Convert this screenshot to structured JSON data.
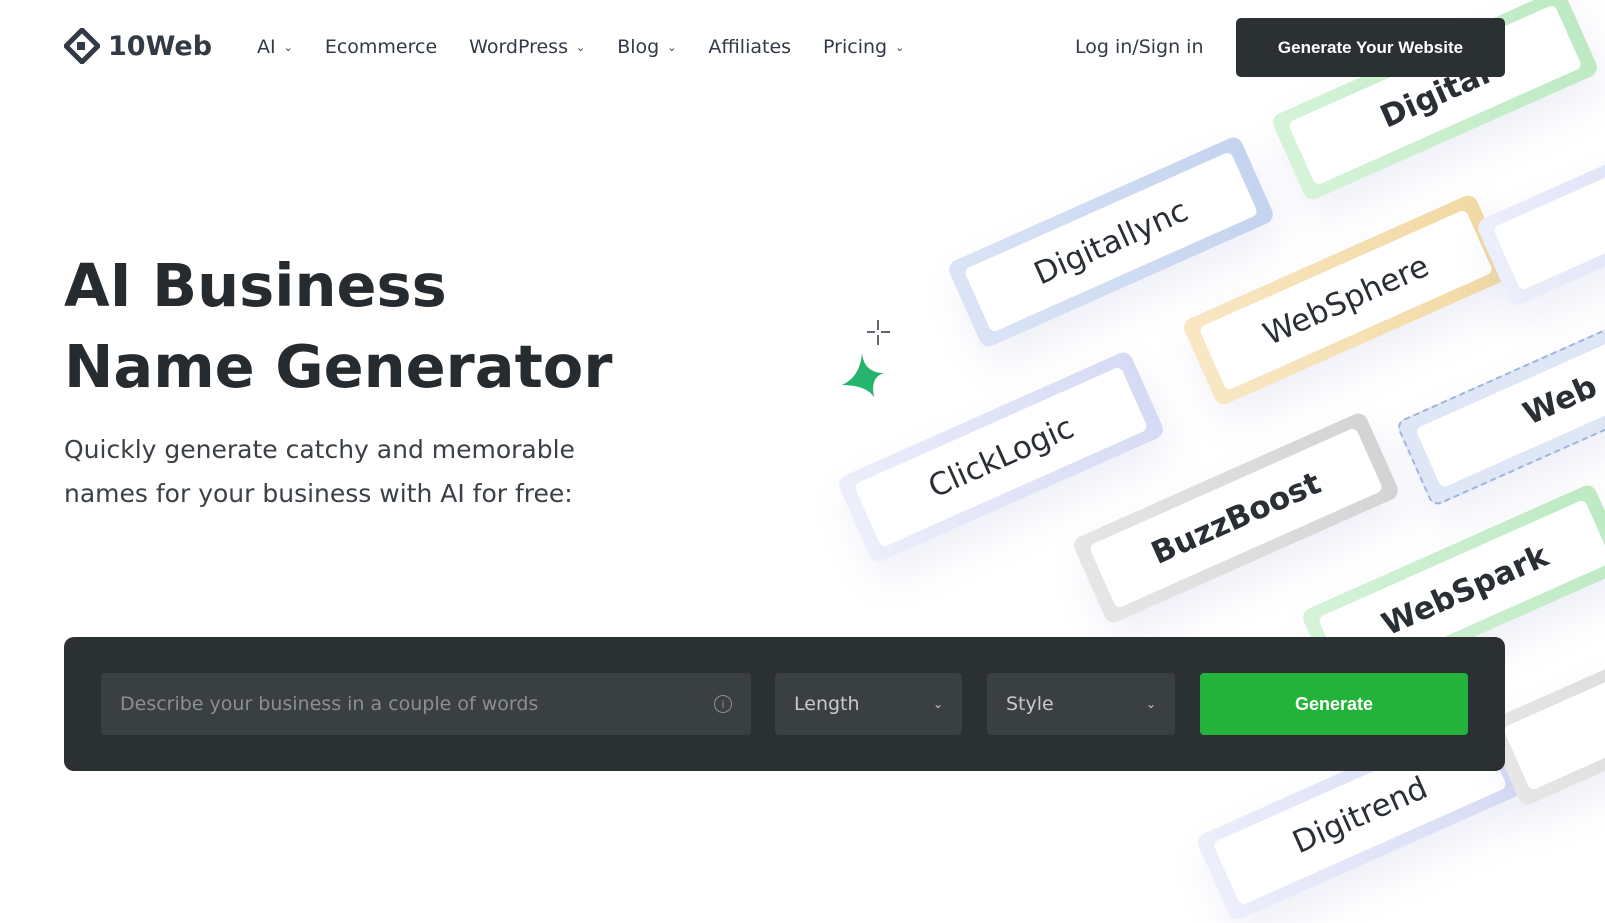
{
  "nav": {
    "brand": "10Web",
    "items": [
      {
        "label": "AI",
        "dropdown": true
      },
      {
        "label": "Ecommerce",
        "dropdown": false
      },
      {
        "label": "WordPress",
        "dropdown": true
      },
      {
        "label": "Blog",
        "dropdown": true
      },
      {
        "label": "Affiliates",
        "dropdown": false
      },
      {
        "label": "Pricing",
        "dropdown": true
      }
    ],
    "login": "Log in/Sign in",
    "cta": "Generate Your Website"
  },
  "hero": {
    "title_line1": "AI Business",
    "title_line2": "Name Generator",
    "subtitle": "Quickly generate catchy and memorable names for your business with AI for free:"
  },
  "cards": [
    "Digital",
    "Digitallync",
    "WebSphere",
    "ClickLogic",
    "BuzzBoost",
    "Web",
    "WebSpark",
    "Digitrend"
  ],
  "form": {
    "placeholder": "Describe your business in a couple of words",
    "length": "Length",
    "style": "Style",
    "generate": "Generate"
  },
  "colors": {
    "accent": "#23b33a",
    "dark": "#2b3033"
  }
}
